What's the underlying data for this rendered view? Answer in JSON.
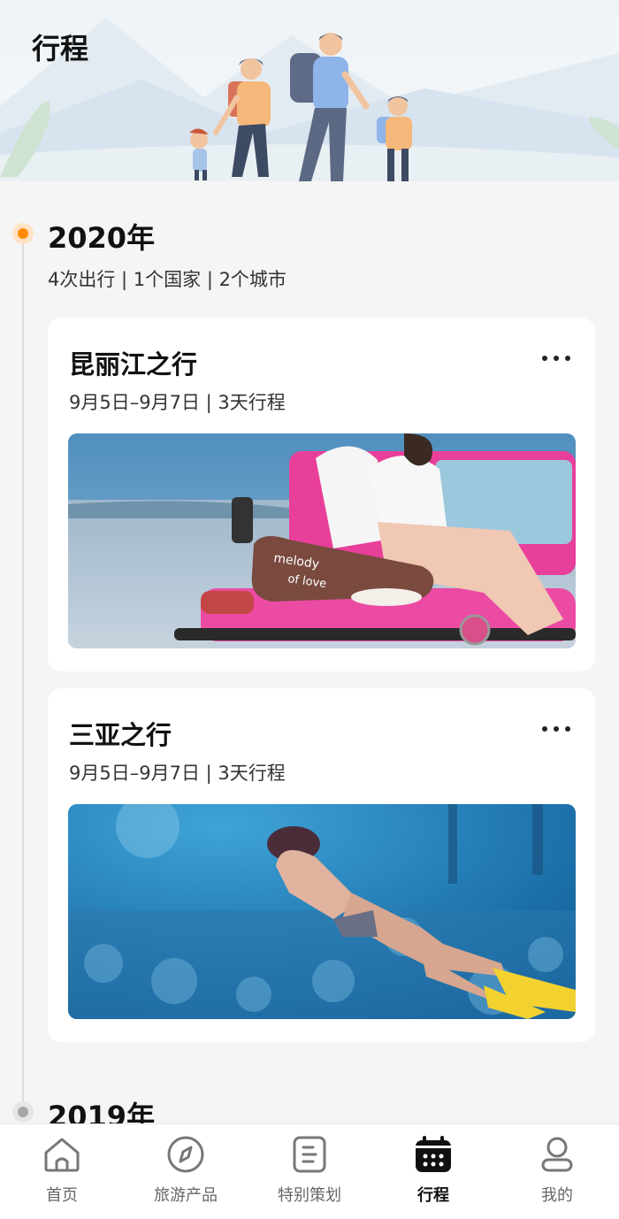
{
  "header": {
    "title": "行程"
  },
  "years": [
    {
      "year": "2020年",
      "stats": "4次出行 | 1个国家 | 2个城市"
    },
    {
      "year": "2019年"
    }
  ],
  "trips": [
    {
      "title": "昆丽江之行",
      "subtitle": "9月5日–9月7日 | 3天行程",
      "photo_text": [
        "melody",
        "of love"
      ]
    },
    {
      "title": "三亚之行",
      "subtitle": "9月5日–9月7日 | 3天行程"
    }
  ],
  "tabs": [
    {
      "label": "首页",
      "icon": "home-icon"
    },
    {
      "label": "旅游产品",
      "icon": "compass-icon"
    },
    {
      "label": "特别策划",
      "icon": "document-icon"
    },
    {
      "label": "行程",
      "icon": "calendar-icon",
      "active": true
    },
    {
      "label": "我的",
      "icon": "user-icon"
    }
  ],
  "colors": {
    "accent": "#ff8a00",
    "text": "#111111",
    "inactive_dot": "#a6a6a6"
  }
}
